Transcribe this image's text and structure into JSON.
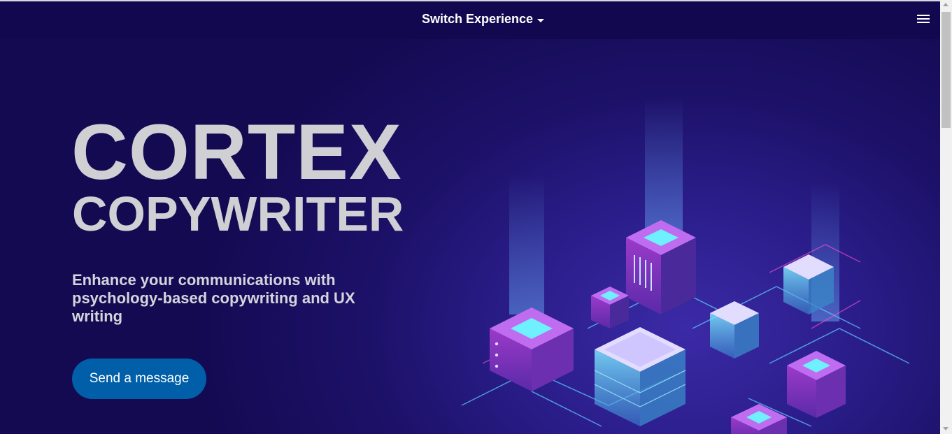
{
  "header": {
    "switch_label": "Switch Experience",
    "menu_icon": "hamburger-menu-icon"
  },
  "hero": {
    "title_line1": "CORTEX",
    "title_line2": "COPYWRITER",
    "subtitle": "Enhance your communications with psychology-based copywriting and UX writing",
    "cta_label": "Send a message"
  },
  "illustration": {
    "description_icon": "isometric-servers-illustration"
  },
  "colors": {
    "background": "#140a52",
    "header": "#120850",
    "title_text": "#cfcfd4",
    "cta": "#005fa8"
  }
}
